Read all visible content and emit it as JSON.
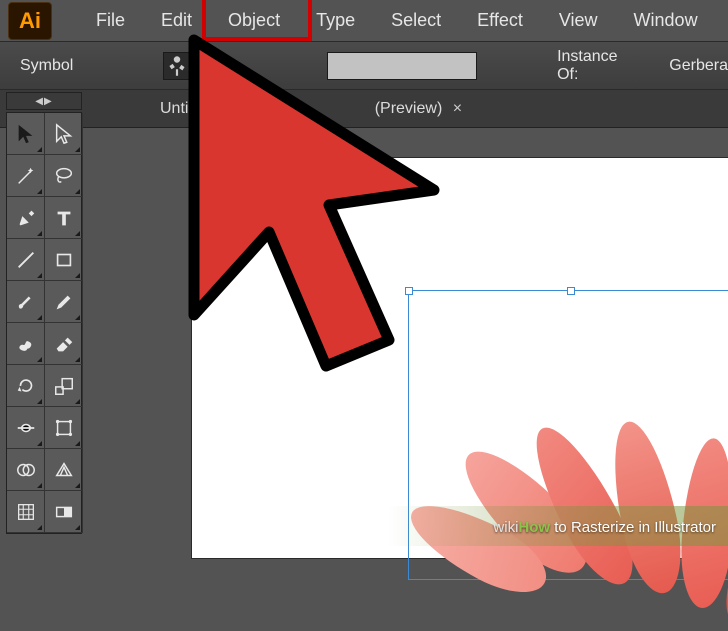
{
  "app": {
    "logo_text": "Ai"
  },
  "menu": [
    {
      "label": "File"
    },
    {
      "label": "Edit"
    },
    {
      "label": "Object",
      "highlighted": true
    },
    {
      "label": "Type"
    },
    {
      "label": "Select"
    },
    {
      "label": "Effect"
    },
    {
      "label": "View"
    },
    {
      "label": "Window"
    }
  ],
  "controlbar": {
    "left_label": "Symbol",
    "instance_label_partial": "Inst",
    "instance_of_label": "Instance Of:",
    "instance_of_value": "Gerbera"
  },
  "tab": {
    "doc_title": "Untitled-7*",
    "view_mode": "(Preview)",
    "close_glyph": "×"
  },
  "tools": {
    "strip_handle": "◀▶",
    "items": [
      {
        "name": "selection-tool",
        "icon": "cursor-solid"
      },
      {
        "name": "direct-selection-tool",
        "icon": "cursor-outline"
      },
      {
        "name": "magic-wand-tool",
        "icon": "wand"
      },
      {
        "name": "lasso-tool",
        "icon": "lasso"
      },
      {
        "name": "pen-tool",
        "icon": "pen"
      },
      {
        "name": "type-tool",
        "icon": "type"
      },
      {
        "name": "line-tool",
        "icon": "line"
      },
      {
        "name": "rectangle-tool",
        "icon": "rect"
      },
      {
        "name": "paintbrush-tool",
        "icon": "brush"
      },
      {
        "name": "pencil-tool",
        "icon": "pencil"
      },
      {
        "name": "blob-brush-tool",
        "icon": "blob"
      },
      {
        "name": "eraser-tool",
        "icon": "eraser"
      },
      {
        "name": "rotate-tool",
        "icon": "rotate"
      },
      {
        "name": "scale-tool",
        "icon": "scale"
      },
      {
        "name": "width-tool",
        "icon": "width"
      },
      {
        "name": "free-transform-tool",
        "icon": "freex"
      },
      {
        "name": "shape-builder-tool",
        "icon": "shapeb"
      },
      {
        "name": "perspective-tool",
        "icon": "persp"
      },
      {
        "name": "mesh-tool",
        "icon": "mesh"
      },
      {
        "name": "gradient-tool",
        "icon": "grad"
      }
    ]
  },
  "watermark": {
    "wiki": "wiki",
    "how": "How",
    "tail": " to Rasterize in Illustrator"
  },
  "colors": {
    "cursor_fill": "#d9362f",
    "cursor_stroke": "#000000",
    "highlight_red": "#d20000",
    "petal_light": "#f28b82",
    "petal_dark": "#e85c52"
  }
}
